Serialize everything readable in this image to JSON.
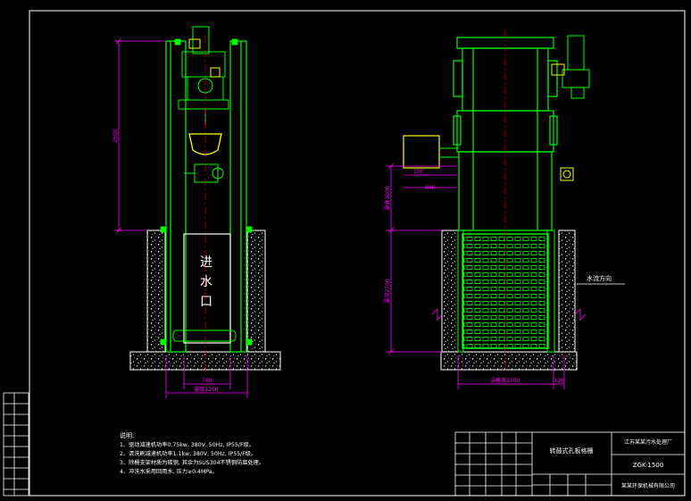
{
  "left_view": {
    "height_dim": "2600",
    "inlet_label": [
      "进",
      "水",
      "口"
    ],
    "width_dim_inner": "760",
    "width_dim_outer": "渠宽1200"
  },
  "right_view": {
    "dim_height_top": "渠高3000",
    "dim_800": "800",
    "dim_150": "150",
    "dim_depth": "渠深2700",
    "flow_label": "水流方向",
    "equip_width": "设备宽1500",
    "dim_120": "120"
  },
  "notes": {
    "title": "说明:",
    "lines": [
      "1、驱动减速机功率0.75kw, 380V, 50Hz, IP55/F级。",
      "2、清洗刷减速机功率1.1kw, 380V, 50Hz, IP55/F级。",
      "3、除栅支架材质为碳钢, 其余为SUS304不锈钢防腐处理。",
      "4、冲洗水采用回用水, 压力≥0.4MPa。"
    ]
  },
  "title_block": {
    "drawing_name": "转鼓式孔板格栅",
    "model": "ZGK-1500",
    "project": "江苏某某污水处理厂",
    "maker": "某某环保机械有限公司"
  },
  "colors": {
    "frame": "#ffffff",
    "equipment": "#00ff00",
    "motor": "#00ff00",
    "dimension": "#ff00ff",
    "channel_wall": "#ffffff",
    "centerline": "#ff0000",
    "drive": "#ffff00"
  }
}
